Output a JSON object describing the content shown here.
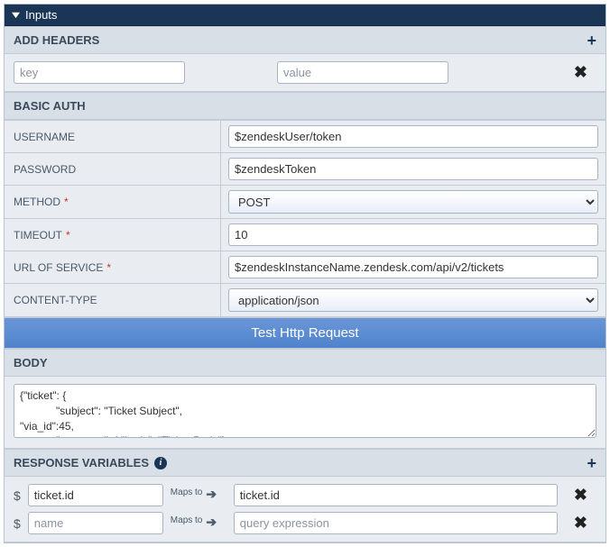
{
  "titlebar": {
    "label": "Inputs"
  },
  "headers": {
    "title": "ADD HEADERS",
    "key_placeholder": "key",
    "value_placeholder": "value"
  },
  "basicAuth": {
    "title": "BASIC AUTH",
    "usernameLabel": "USERNAME",
    "usernameValue": "$zendeskUser/token",
    "passwordLabel": "PASSWORD",
    "passwordValue": "$zendeskToken"
  },
  "method": {
    "label": "METHOD",
    "value": "POST"
  },
  "timeout": {
    "label": "TIMEOUT",
    "value": "10"
  },
  "url": {
    "label": "URL OF SERVICE",
    "value": "$zendeskInstanceName.zendesk.com/api/v2/tickets"
  },
  "contentType": {
    "label": "CONTENT-TYPE",
    "value": "application/json"
  },
  "testBtn": "Test Http Request",
  "body": {
    "title": "BODY",
    "value": "{\"ticket\": {\n            \"subject\": \"Ticket Subject\",\n\"via_id\":45,\n            \"comment\": { \"body\": \"Ticket Body\"},"
  },
  "responseVars": {
    "title": "RESPONSE VARIABLES",
    "mapsTo": "Maps to",
    "rows": [
      {
        "name": "ticket.id",
        "expr": "ticket.id",
        "namePlaceholder": "name",
        "exprPlaceholder": "query expression"
      },
      {
        "name": "",
        "expr": "",
        "namePlaceholder": "name",
        "exprPlaceholder": "query expression"
      }
    ]
  },
  "requiredMark": "*"
}
